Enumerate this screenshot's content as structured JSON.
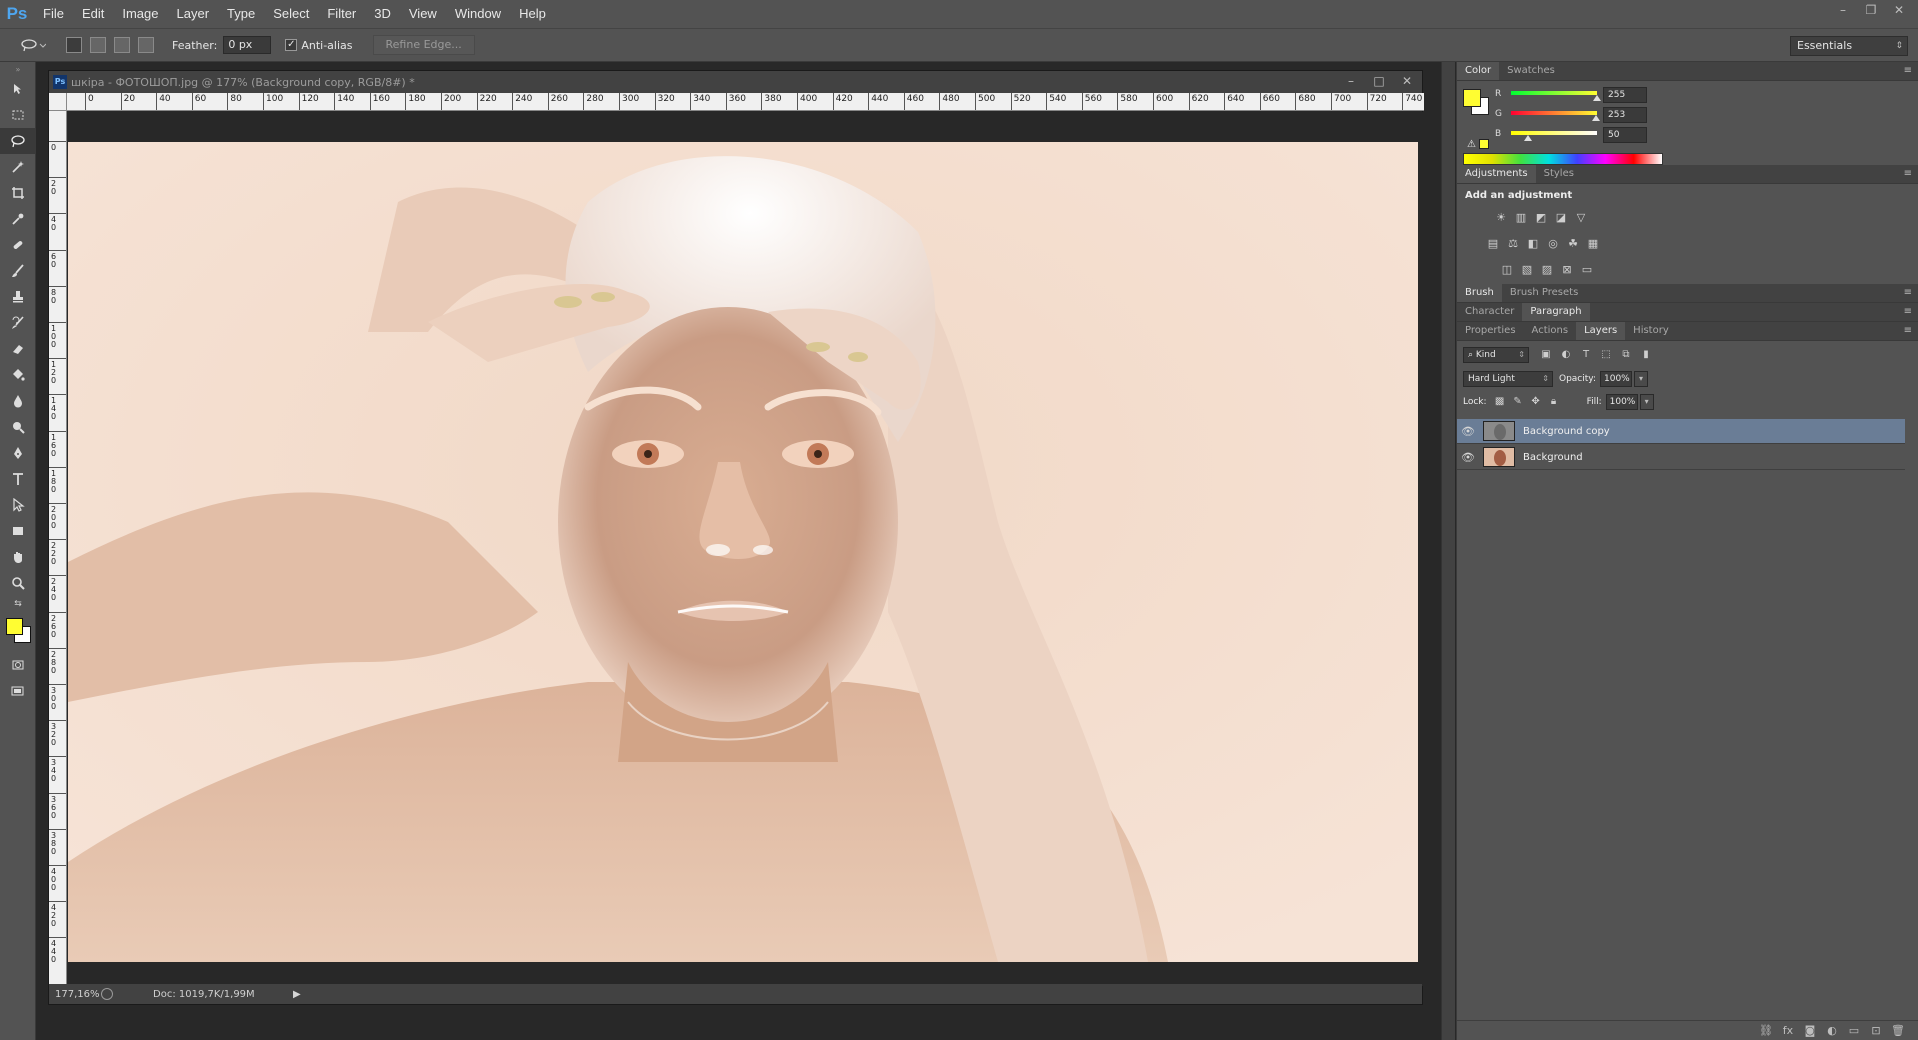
{
  "app": {
    "logo": "Ps"
  },
  "menu": [
    "File",
    "Edit",
    "Image",
    "Layer",
    "Type",
    "Select",
    "Filter",
    "3D",
    "View",
    "Window",
    "Help"
  ],
  "window_controls": {
    "minimize": "–",
    "restore": "❐",
    "close": "✕"
  },
  "options": {
    "feather_label": "Feather:",
    "feather_value": "0 px",
    "antialias_label": "Anti-alias",
    "antialias_checked": "✓",
    "refine_edge": "Refine Edge...",
    "workspace": "Essentials"
  },
  "document": {
    "title": "шкіра - ФОТОШОП.jpg @ 177% (Background copy, RGB/8#) *",
    "ps_badge": "Ps",
    "zoom": "177,16%",
    "doc_info": "Doc: 1019,7K/1,99M",
    "ruler_h": [
      "0",
      "20",
      "40",
      "60",
      "80",
      "100",
      "120",
      "140",
      "160",
      "180",
      "200",
      "220",
      "240",
      "260",
      "280",
      "300",
      "320",
      "340",
      "360",
      "380",
      "400",
      "420",
      "440",
      "460",
      "480",
      "500",
      "520",
      "540",
      "560",
      "580",
      "600",
      "620",
      "640",
      "660",
      "680",
      "700",
      "720",
      "740"
    ],
    "ruler_v": [
      "0",
      "20",
      "40",
      "60",
      "80",
      "100",
      "120",
      "140",
      "160",
      "180",
      "200",
      "220",
      "240",
      "260",
      "280",
      "300",
      "320",
      "340",
      "360",
      "380",
      "400",
      "420",
      "440"
    ]
  },
  "color_panel": {
    "tabs": [
      "Color",
      "Swatches"
    ],
    "r_label": "R",
    "r_value": "255",
    "g_label": "G",
    "g_value": "253",
    "b_label": "B",
    "b_value": "50",
    "r": 255,
    "g": 253,
    "b": 50,
    "fg_color": "#fffd32",
    "bg_color": "#ffffff"
  },
  "adjustments": {
    "tabs": [
      "Adjustments",
      "Styles"
    ],
    "title": "Add an adjustment"
  },
  "brush_tabs": [
    "Brush",
    "Brush Presets"
  ],
  "char_tabs": [
    "Character",
    "Paragraph"
  ],
  "layers_panel": {
    "tabs": [
      "Properties",
      "Actions",
      "Layers",
      "History"
    ],
    "kind": "Kind",
    "blend_mode": "Hard Light",
    "opacity_label": "Opacity:",
    "opacity_value": "100%",
    "lock_label": "Lock:",
    "fill_label": "Fill:",
    "fill_value": "100%",
    "layers": [
      {
        "name": "Background copy",
        "selected": true
      },
      {
        "name": "Background",
        "selected": false
      }
    ]
  }
}
